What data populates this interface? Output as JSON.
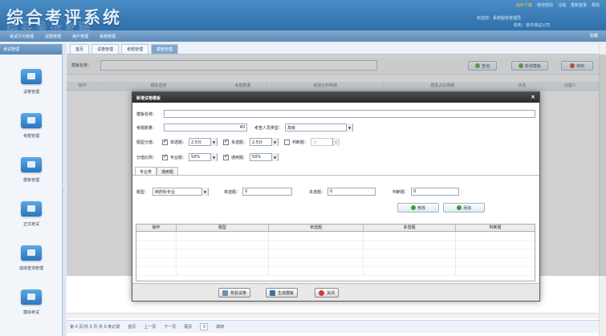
{
  "header": {
    "title": "综合考评系统",
    "top_links": [
      "操作下载",
      "修改密码",
      "注销",
      "重新登录",
      "帮助"
    ],
    "welcome": "欢迎您：系统超级管理员",
    "org": "机构：软件测试公司"
  },
  "nav": {
    "items": [
      "考试行为管理",
      "试题管理",
      "用户管理",
      "系统管理"
    ],
    "help": "隐藏"
  },
  "sidebar": {
    "header": "考试管理",
    "items": [
      {
        "label": "试卷管理",
        "icon": "exam-paper-icon"
      },
      {
        "label": "考题管理",
        "icon": "question-bank-icon"
      },
      {
        "label": "模板管理",
        "icon": "template-icon"
      },
      {
        "label": "正式考试",
        "icon": "formal-exam-icon"
      },
      {
        "label": "成绩查询管理",
        "icon": "score-query-icon"
      },
      {
        "label": "模拟考试",
        "icon": "mock-exam-icon"
      }
    ]
  },
  "main": {
    "tabs": [
      "首页",
      "试卷管理",
      "考题管理",
      "模板管理"
    ],
    "search": {
      "label": "模板名称：",
      "value": ""
    },
    "buttons": {
      "query": "查询",
      "add": "新增模板",
      "delete": "停用"
    },
    "columns": [
      "操作",
      "模板名称",
      "考题数量",
      "考题分布明细",
      "题型占比明细",
      "状态",
      "创建人"
    ],
    "pager": {
      "info": "第 0 页/共 0 页  共 0 条记录",
      "first": "首页",
      "prev": "上一页",
      "next": "下一页",
      "last": "尾页",
      "page_input": "0",
      "go": "跳转"
    }
  },
  "dialog": {
    "title": "新增试卷模板",
    "close": "×",
    "template_name_label": "模板名称：",
    "template_name_value": "",
    "total_questions_label": "考题数量：",
    "total_questions_value": "40",
    "category_label": "考查人员类型：",
    "category_value": "高级",
    "type_ratio_label": "题型分值：",
    "single_label": "单选题：",
    "single_value": "2.5分",
    "multi_label": "多选题：",
    "multi_value": "2.5分",
    "judge_label": "判断题：",
    "judge_value": "分",
    "distrib_label": "分值比例：",
    "prof_label": "专业题：",
    "prof_value": "50%",
    "general_label": "通用题：",
    "general_value": "50%",
    "sub_tabs": [
      "专业类",
      "通用题"
    ],
    "subject_label": "题型：",
    "subject_value": "西药科专业",
    "q_single_label": "单选题：",
    "q_single_value": "0",
    "q_multi_label": "多选题：",
    "q_multi_value": "0",
    "q_judge_label": "判断题：",
    "q_judge_value": "0",
    "btn_modify": "修改",
    "btn_add": "添加",
    "table_columns": [
      "操作",
      "题型",
      "单选题",
      "多选题",
      "判断题"
    ],
    "footer": {
      "check": "校验试卷",
      "generate": "生成模板",
      "close": "关闭"
    }
  },
  "colors": {
    "header_blue": "#2f6fab",
    "icon_blue": "#2c75bf",
    "dialog_header": "#2b2b2b",
    "accent_orange": "#ffc34a"
  }
}
